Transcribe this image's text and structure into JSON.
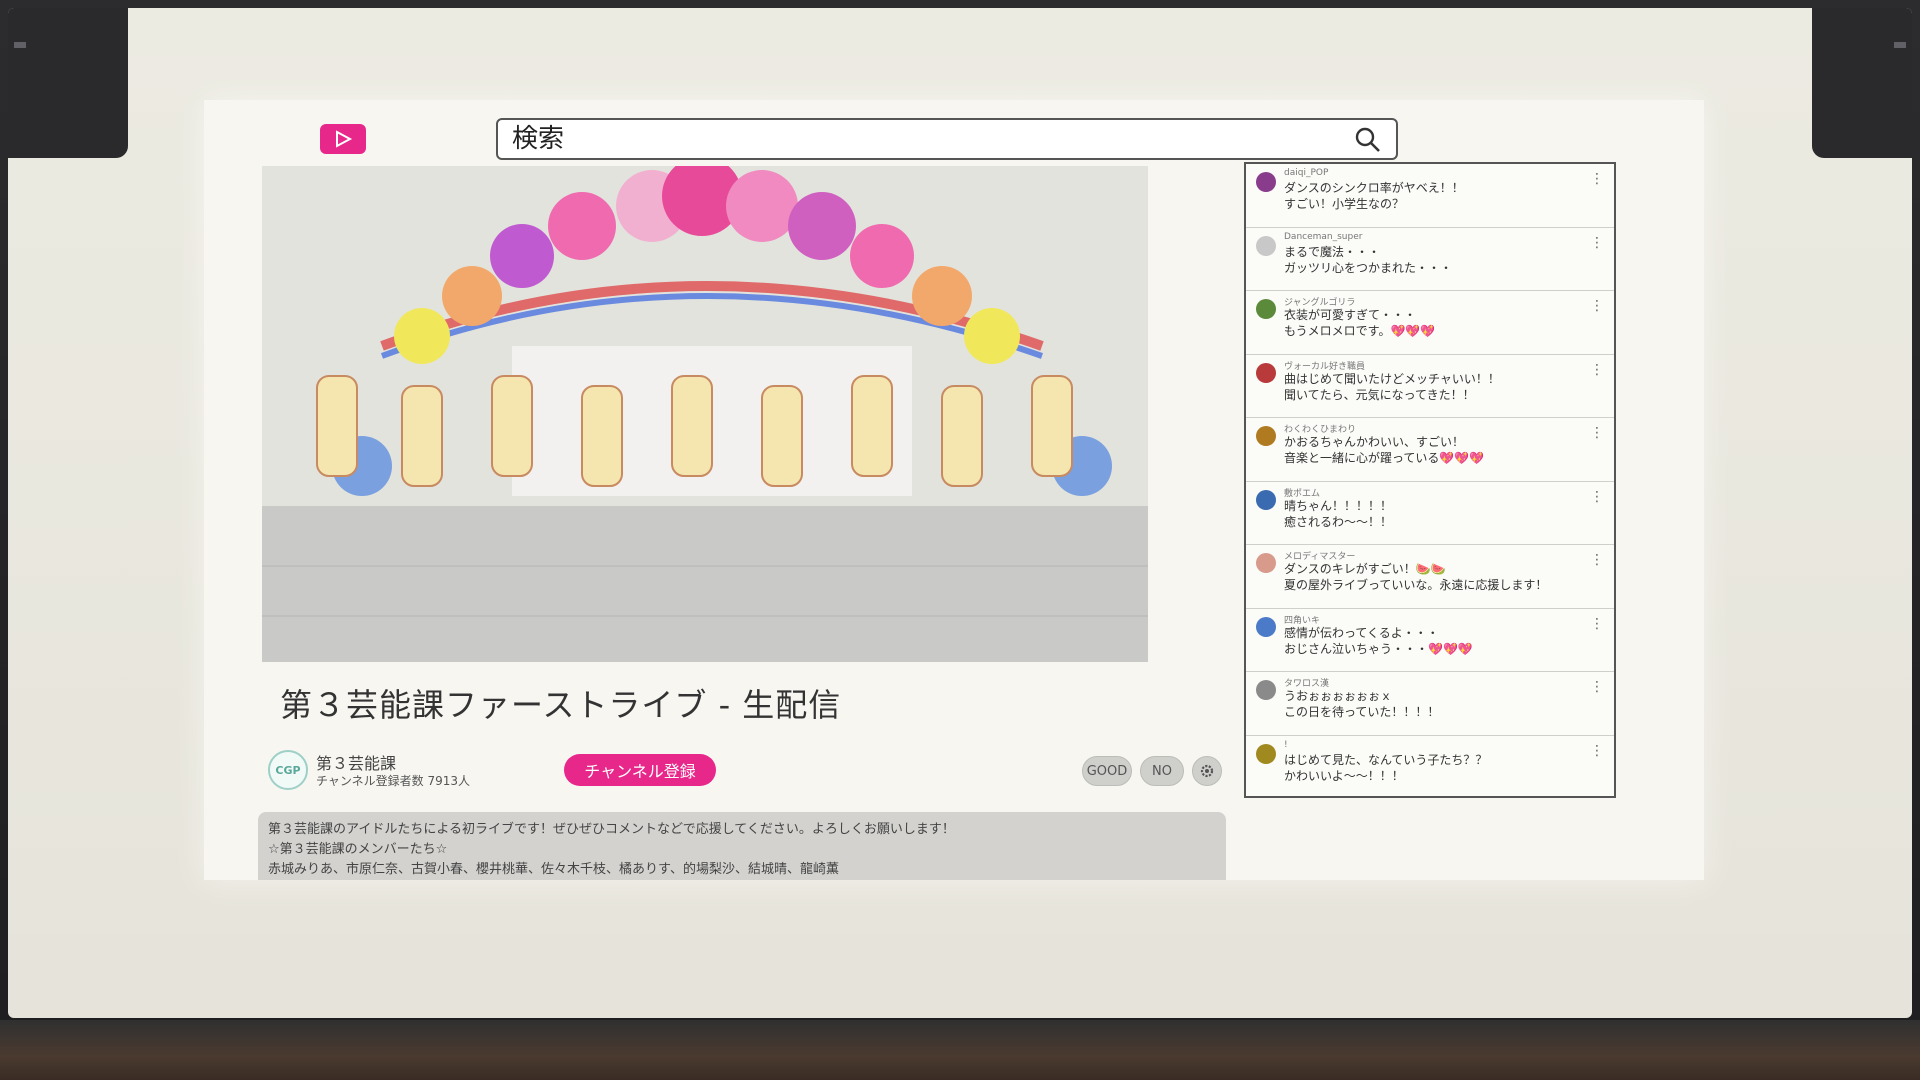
{
  "search": {
    "placeholder": "検索"
  },
  "video": {
    "title": "第３芸能課ファーストライブ - 生配信"
  },
  "channel": {
    "avatar_text": "CGP",
    "name": "第３芸能課",
    "subscribers": "チャンネル登録者数 7913人",
    "subscribe_label": "チャンネル登録"
  },
  "actions": {
    "good_label": "GOOD",
    "no_label": "NO"
  },
  "description": {
    "line1": "第３芸能課のアイドルたちによる初ライブです！ぜひぜひコメントなどで応援してください。よろしくお願いします！",
    "line2": "☆第３芸能課のメンバーたち☆",
    "line3": "赤城みりあ、市原仁奈、古賀小春、櫻井桃華、佐々木千枝、橘ありす、的場梨沙、結城晴、龍崎薫"
  },
  "comments": [
    {
      "user": "daiqi_POP",
      "line1": "ダンスのシンクロ率がヤベえ！！",
      "line2": "すごい！小学生なの？",
      "color": "#8a3c8c"
    },
    {
      "user": "Danceman_super",
      "line1": "まるで魔法・・・",
      "line2": "ガッツリ心をつかまれた・・・",
      "color": "#c8c8c8"
    },
    {
      "user": "ジャングルゴリラ",
      "line1": "衣装が可愛すぎて・・・",
      "line2": "もうメロメロです。💖💖💖",
      "color": "#5a8a3a"
    },
    {
      "user": "ヴォーカル好き職員",
      "line1": "曲はじめて聞いたけどメッチャいい！！",
      "line2": "聞いてたら、元気になってきた！！",
      "color": "#b83a3a"
    },
    {
      "user": "わくわくひまわり",
      "line1": "かおるちゃんかわいい、すごい！",
      "line2": "音楽と一緒に心が躍っている💖💖💖",
      "color": "#b07a20"
    },
    {
      "user": "敷ポエム",
      "line1": "晴ちゃん！！！！！",
      "line2": "癒されるわ〜〜！！",
      "color": "#3a6ab0"
    },
    {
      "user": "メロディマスター",
      "line1": "ダンスのキレがすごい！🍉🍉",
      "line2": "夏の屋外ライブっていいな。永遠に応援します！",
      "color": "#d89a8a"
    },
    {
      "user": "四角いキ",
      "line1": "感情が伝わってくるよ・・・",
      "line2": "おじさん泣いちゃう・・・💖💖💖",
      "color": "#4a7ac8"
    },
    {
      "user": "タワロス漢",
      "line1": "うおぉぉぉぉぉぉｘ",
      "line2": "この日を待っていた！！！！",
      "color": "#8a8a8a"
    },
    {
      "user": "!",
      "line1": "はじめて見た、なんていう子たち？？",
      "line2": "かわいいよ〜〜！！！",
      "color": "#a08a20"
    }
  ],
  "colors": {
    "accent": "#e8278a"
  }
}
